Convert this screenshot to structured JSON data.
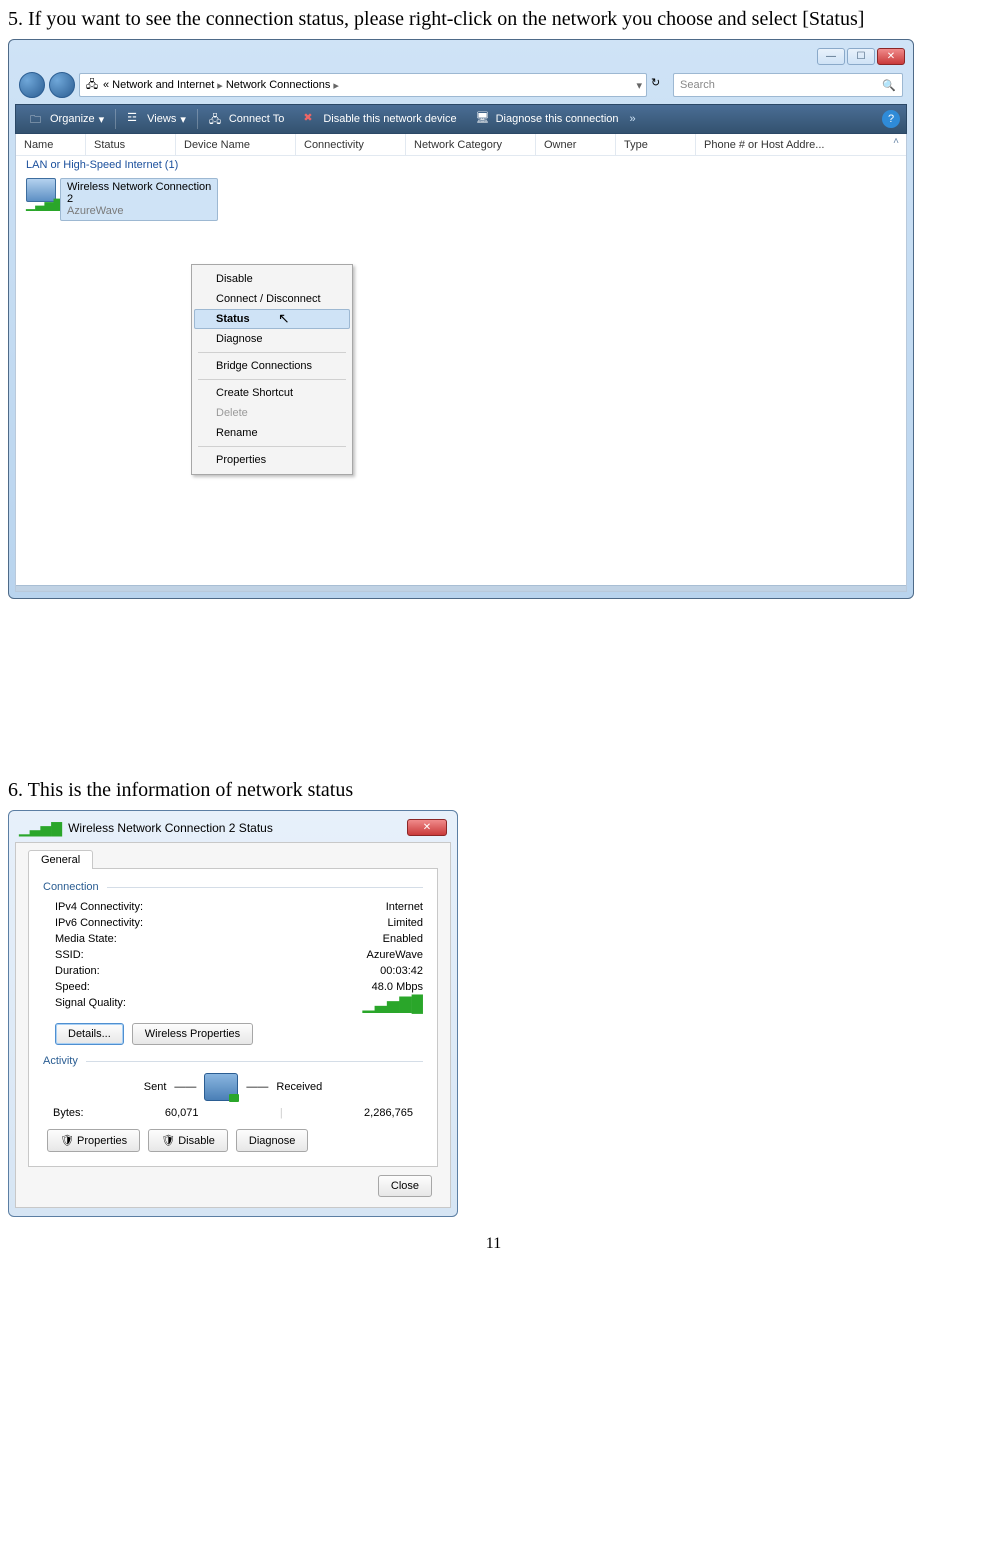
{
  "step5": "5. If you want to see the connection status, please right-click on the network you choose and select [Status]",
  "step6": "6. This is the information of network status",
  "pageNumber": "11",
  "explorer": {
    "breadcrumb": {
      "root": "«  Network and Internet",
      "leaf": "Network Connections"
    },
    "search": {
      "placeholder": "Search"
    },
    "toolbar": {
      "organize": "Organize",
      "views": "Views",
      "connect": "Connect To",
      "disable": "Disable this network device",
      "diagnose": "Diagnose this connection"
    },
    "columns": [
      "Name",
      "Status",
      "Device Name",
      "Connectivity",
      "Network Category",
      "Owner",
      "Type",
      "Phone # or Host Addre..."
    ],
    "group": "LAN or High-Speed Internet (1)",
    "item": {
      "line1": "Wireless Network Connection",
      "line2": "2",
      "ssid": "AzureWave"
    },
    "context": {
      "disable": "Disable",
      "connect": "Connect / Disconnect",
      "status": "Status",
      "diagnose": "Diagnose",
      "bridge": "Bridge Connections",
      "shortcut": "Create Shortcut",
      "delete": "Delete",
      "rename": "Rename",
      "properties": "Properties"
    }
  },
  "dialog": {
    "title": "Wireless Network Connection 2 Status",
    "tab": "General",
    "groups": {
      "connection": "Connection",
      "activity": "Activity"
    },
    "connection": {
      "ipv4_l": "IPv4 Connectivity:",
      "ipv4_v": "Internet",
      "ipv6_l": "IPv6 Connectivity:",
      "ipv6_v": "Limited",
      "media_l": "Media State:",
      "media_v": "Enabled",
      "ssid_l": "SSID:",
      "ssid_v": "AzureWave",
      "dur_l": "Duration:",
      "dur_v": "00:03:42",
      "spd_l": "Speed:",
      "spd_v": "48.0 Mbps",
      "sig_l": "Signal Quality:"
    },
    "buttons": {
      "details": "Details...",
      "wprops": "Wireless Properties",
      "properties": "Properties",
      "disable": "Disable",
      "diagnose": "Diagnose",
      "close": "Close"
    },
    "activity": {
      "sent": "Sent",
      "recv": "Received",
      "bytes_l": "Bytes:",
      "sent_v": "60,071",
      "recv_v": "2,286,765"
    }
  }
}
